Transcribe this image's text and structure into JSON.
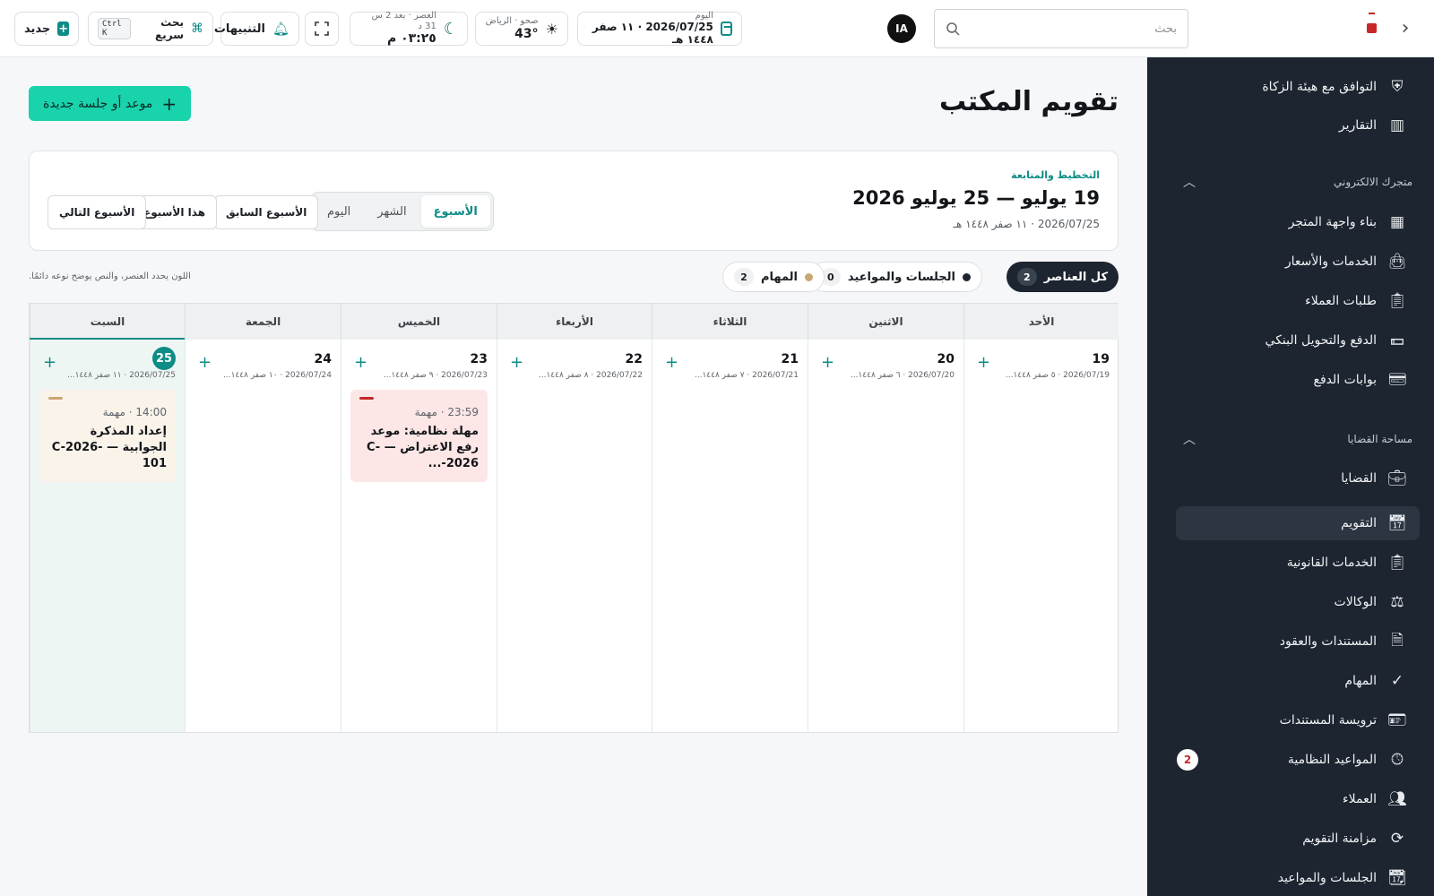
{
  "topbar": {
    "search_placeholder": "بحث",
    "avatar_initials": "IA",
    "today_label": "اليوم",
    "today_value": "2026/07/25 · ١١ صفر ١٤٤٨ هـ",
    "weather_label": "صحو · الرياض",
    "weather_value": "43°",
    "prayer_label": "العصر · بعد 2 س 31 د",
    "prayer_value": "٠٣:٢٥ م",
    "alerts_label": "التنبيهات",
    "quick_search_label": "بحث سريع",
    "quick_search_kbd": "Ctrl K",
    "new_label": "جديد"
  },
  "sidebar": {
    "items_top": [
      {
        "label": "التوافق مع هيئة الزكاة",
        "icon": "shield-check-icon"
      },
      {
        "label": "التقارير",
        "icon": "chart-icon"
      }
    ],
    "section_store": "متجرك الالكتروني",
    "items_store": [
      {
        "label": "بناء واجهة المتجر",
        "icon": "grid-icon"
      },
      {
        "label": "الخدمات والأسعار",
        "icon": "bag-icon"
      },
      {
        "label": "طلبات العملاء",
        "icon": "clipboard-icon"
      },
      {
        "label": "الدفع والتحويل البنكي",
        "icon": "money-icon"
      },
      {
        "label": "بوابات الدفع",
        "icon": "card-icon"
      }
    ],
    "section_cases": "مساحة القضايا",
    "items_cases": [
      {
        "label": "القضايا",
        "icon": "briefcase-icon"
      },
      {
        "label": "التقويم",
        "icon": "calendar-icon"
      },
      {
        "label": "الخدمات القانونية",
        "icon": "clipboard-list-icon"
      },
      {
        "label": "الوكالات",
        "icon": "scales-icon"
      },
      {
        "label": "المستندات والعقود",
        "icon": "document-icon"
      },
      {
        "label": "المهام",
        "icon": "check-circle-icon"
      },
      {
        "label": "ترويسة المستندات",
        "icon": "id-card-icon"
      },
      {
        "label": "المواعيد النظامية",
        "icon": "clock-icon",
        "badge": "2"
      },
      {
        "label": "العملاء",
        "icon": "users-icon"
      },
      {
        "label": "مزامنة التقويم",
        "icon": "sync-icon"
      },
      {
        "label": "الجلسات والمواعيد",
        "icon": "calendar-grid-icon"
      }
    ]
  },
  "main": {
    "title": "تقويم المكتب",
    "new_button": "موعد أو جلسة جديدة",
    "plan": {
      "kicker": "التخطيط والمتابعة",
      "range": "19 يوليو — 25 يوليو 2026",
      "date": "2026/07/25 · ١١ صفر ١٤٤٨ هـ",
      "views": [
        "الأسبوع",
        "الشهر",
        "اليوم"
      ],
      "prev_week": "الأسبوع السابق",
      "this_week": "هذا الأسبوع",
      "next_week": "الأسبوع التالي"
    },
    "filters": [
      {
        "label": "كل العناصر",
        "count": "2"
      },
      {
        "label": "الجلسات والمواعيد",
        "count": "0"
      },
      {
        "label": "المهام",
        "count": "2"
      }
    ],
    "legend_note": "اللون يحدد العنصر، والنص يوضح نوعه دائمًا."
  },
  "calendar": {
    "days": [
      {
        "name": "الأحد",
        "num": "19",
        "sub": "2026/07/19 · ٥ صفر ١٤٤٨..."
      },
      {
        "name": "الاثنين",
        "num": "20",
        "sub": "2026/07/20 · ٦ صفر ١٤٤٨..."
      },
      {
        "name": "الثلاثاء",
        "num": "21",
        "sub": "2026/07/21 · ٧ صفر ١٤٤٨..."
      },
      {
        "name": "الأربعاء",
        "num": "22",
        "sub": "2026/07/22 · ٨ صفر ١٤٤٨..."
      },
      {
        "name": "الخميس",
        "num": "23",
        "sub": "2026/07/23 · ٩ صفر ١٤٤٨..."
      },
      {
        "name": "الجمعة",
        "num": "24",
        "sub": "2026/07/24 · ١٠ صفر ١٤٤٨..."
      },
      {
        "name": "السبت",
        "num": "25",
        "sub": "2026/07/25 · ١١ صفر ١٤٤٨..."
      }
    ],
    "events": [
      {
        "meta": "23:59 · مهمة",
        "title": "مهلة نظامية: موعد رفع الاعتراض — C-2026-..."
      },
      {
        "meta": "14:00 · مهمة",
        "title": "إعداد المذكرة الجوابية — C-2026-101"
      }
    ],
    "colors": {
      "teal": "#0e8c86",
      "red_event": "#fde6e6",
      "beige_event": "#faf3ea",
      "red_bar": "#c62828",
      "beige_bar": "#c9a774"
    }
  }
}
